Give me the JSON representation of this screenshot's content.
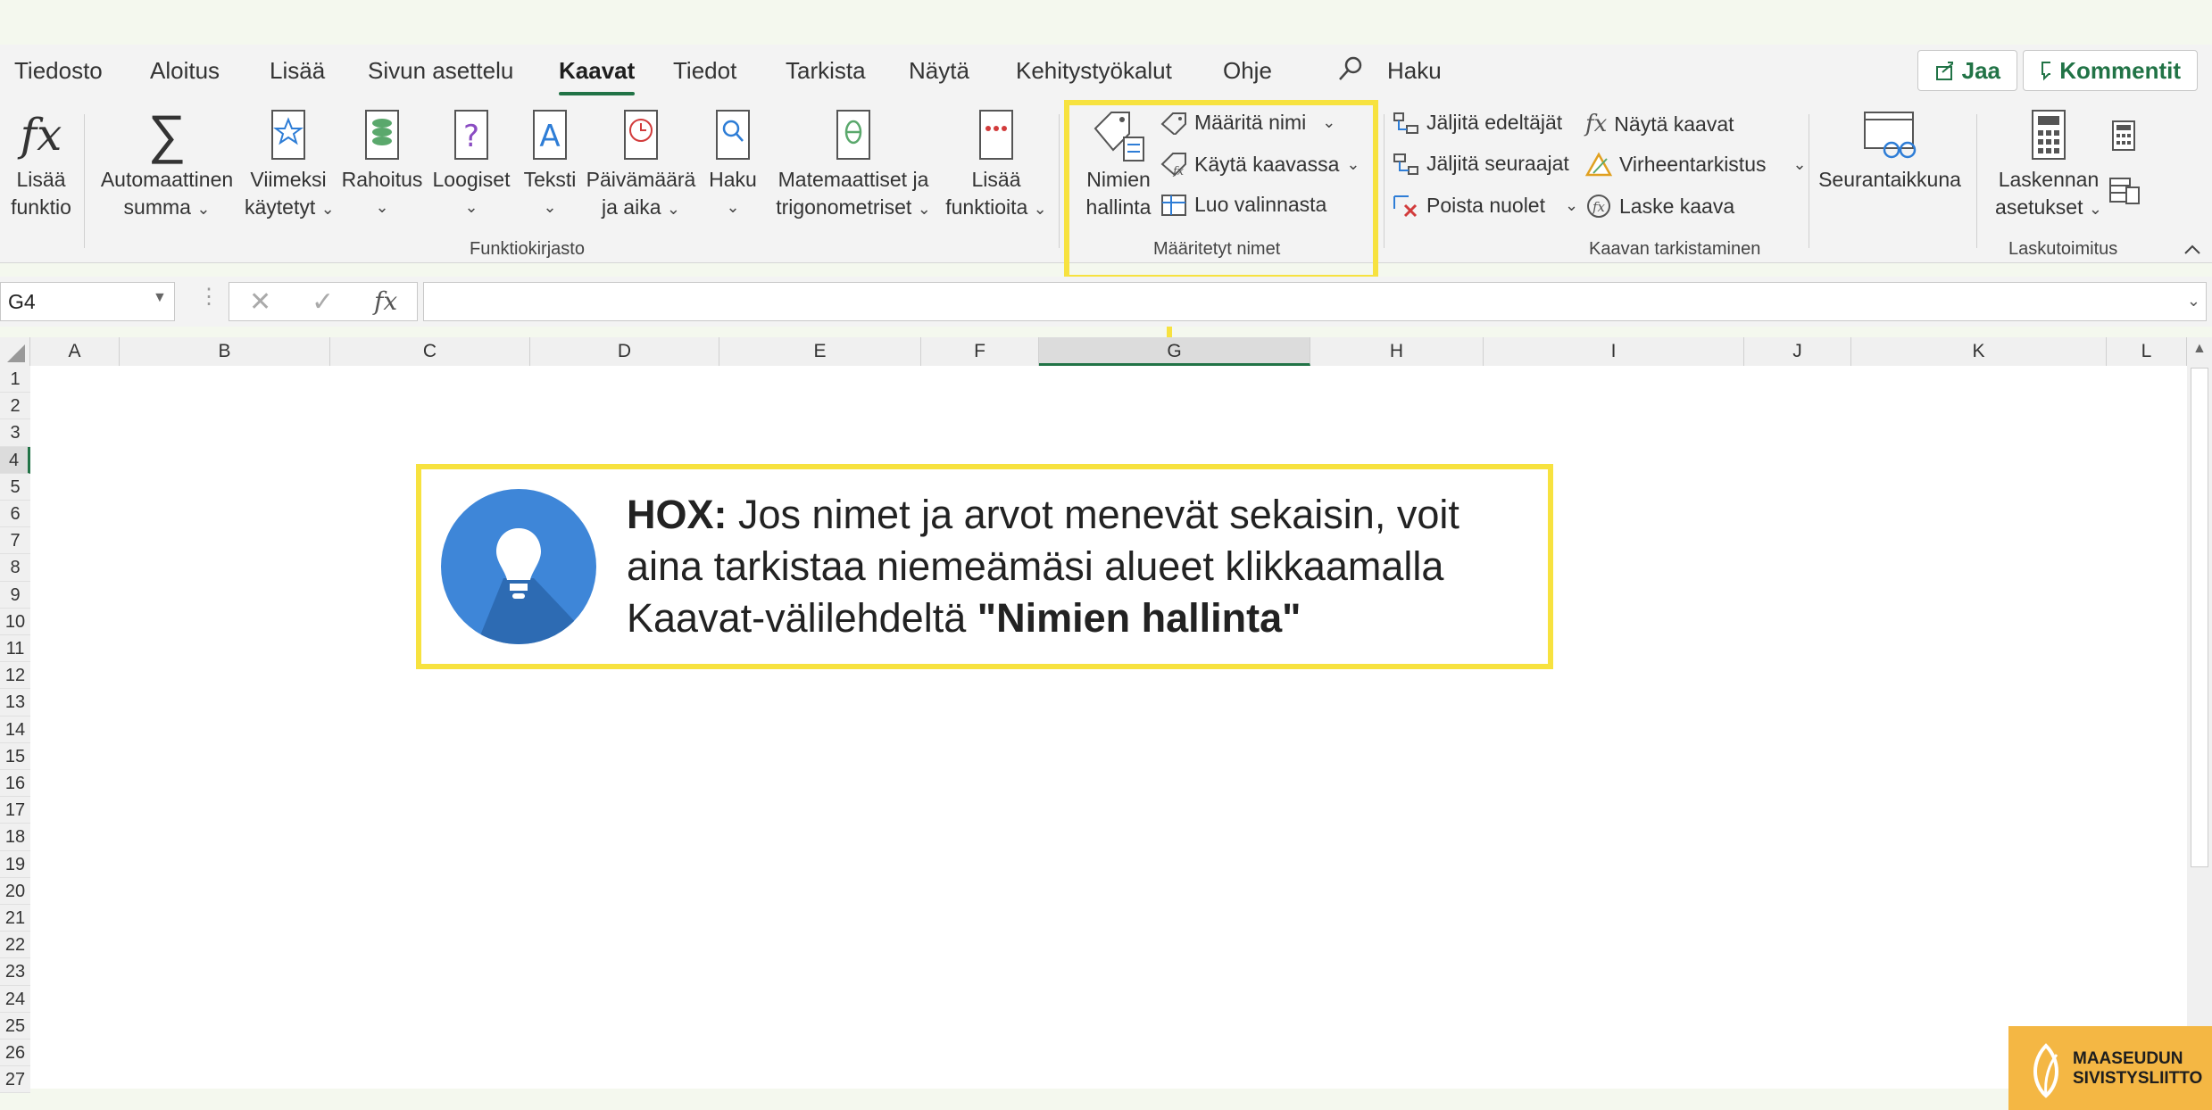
{
  "menu": {
    "tabs": [
      "Tiedosto",
      "Aloitus",
      "Lisää",
      "Sivun asettelu",
      "Kaavat",
      "Tiedot",
      "Tarkista",
      "Näytä",
      "Kehitystyökalut",
      "Ohje"
    ],
    "search": "Haku",
    "share": "Jaa",
    "comments": "Kommentit"
  },
  "ribbon": {
    "insert_function": [
      "Lisää",
      "funktio"
    ],
    "autosum": [
      "Automaattinen",
      "summa"
    ],
    "recent": [
      "Viimeksi",
      "käytetyt"
    ],
    "financial": "Rahoitus",
    "logical": "Loogiset",
    "text": "Teksti",
    "datetime": [
      "Päivämäärä",
      "ja aika"
    ],
    "lookup": "Haku",
    "math": [
      "Matemaattiset ja",
      "trigonometriset"
    ],
    "more": [
      "Lisää",
      "funktioita"
    ],
    "group_library": "Funktiokirjasto",
    "name_manager": [
      "Nimien",
      "hallinta"
    ],
    "define_name": "Määritä nimi",
    "use_in_formula": "Käytä kaavassa",
    "create_from_selection": "Luo valinnasta",
    "group_defined": "Määritetyt nimet",
    "trace_precedents": "Jäljitä edeltäjät",
    "trace_dependents": "Jäljitä seuraajat",
    "remove_arrows": "Poista nuolet",
    "show_formulas": "Näytä kaavat",
    "error_checking": "Virheentarkistus",
    "evaluate_formula": "Laske kaava",
    "group_auditing": "Kaavan tarkistaminen",
    "watch_window": "Seurantaikkuna",
    "calc_options": [
      "Laskennan",
      "asetukset"
    ],
    "group_calc": "Laskutoimitus"
  },
  "formula_bar": {
    "name_box": "G4",
    "fx": "fx"
  },
  "grid": {
    "columns": [
      "A",
      "B",
      "C",
      "D",
      "E",
      "F",
      "G",
      "H",
      "I",
      "J",
      "K",
      "L"
    ],
    "rows": [
      "1",
      "2",
      "3",
      "4",
      "5",
      "6",
      "7",
      "8",
      "9",
      "10",
      "11",
      "12",
      "13",
      "14",
      "15",
      "16",
      "17",
      "18",
      "19",
      "20",
      "21",
      "22",
      "23",
      "24",
      "25",
      "26",
      "27"
    ]
  },
  "callout": {
    "bold_lead": "HOX:",
    "text": " Jos nimet ja arvot menevät sekaisin, voit aina tarkistaa niemeämäsi alueet klikkaamalla Kaavat-välilehdeltä ",
    "bold_tail": "\"Nimien hallinta\""
  },
  "logo": [
    "MAASEUDUN",
    "SIVISTYSLIITTO"
  ],
  "colors": {
    "highlight": "#f7e23f",
    "accent_green": "#217346",
    "bulb_blue": "#3e86d8",
    "logo_orange": "#f4b744"
  }
}
